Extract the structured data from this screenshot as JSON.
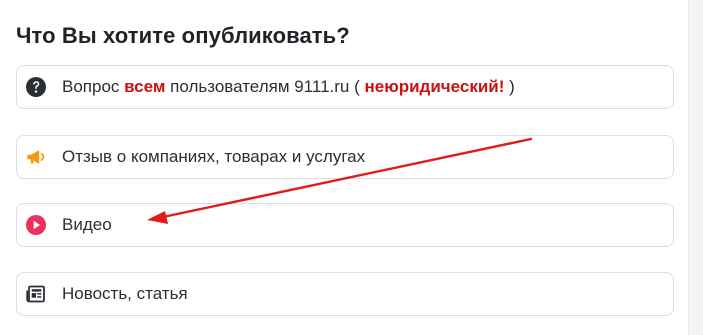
{
  "header": {
    "title": "Что Вы хотите опубликовать?"
  },
  "options": [
    {
      "icon": "question-circle-icon",
      "prefix": "Вопрос ",
      "highlight": "всем",
      "middle": " пользователям 9111.ru ( ",
      "highlight2": "неюридический!",
      "suffix": " )"
    },
    {
      "icon": "megaphone-icon",
      "label": "Отзыв о компаниях, товарах и услугах"
    },
    {
      "icon": "play-circle-icon",
      "label": "Видео"
    },
    {
      "icon": "newspaper-icon",
      "label": "Новость, статья"
    }
  ],
  "colors": {
    "accent_red": "#cc1111",
    "arrow_red": "#e11b1b",
    "megaphone_orange": "#f59a0b",
    "play_red": "#ef2f5c",
    "text_dark": "#2b2f35"
  }
}
